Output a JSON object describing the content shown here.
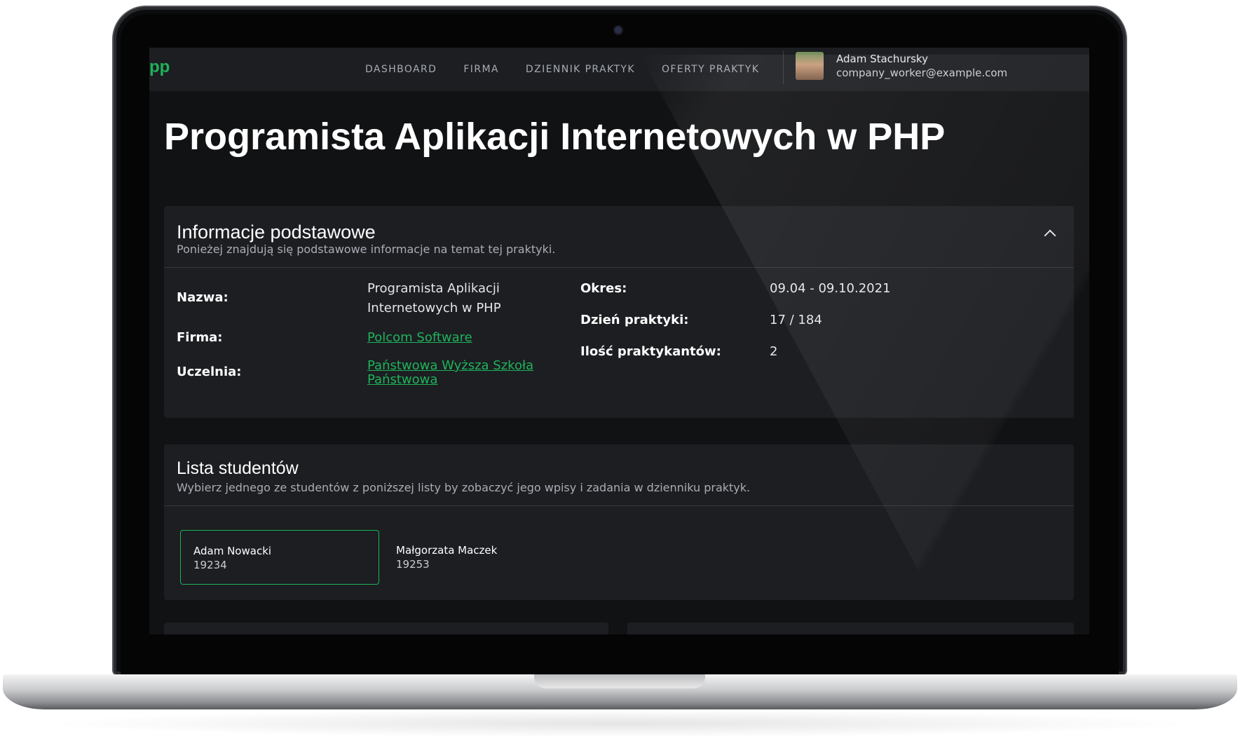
{
  "app": {
    "logo": "pp",
    "nav": [
      "DASHBOARD",
      "FIRMA",
      "DZIENNIK PRAKTYK",
      "OFERTY PRAKTYK"
    ],
    "user": {
      "name": "Adam Stachursky",
      "email": "company_worker@example.com"
    },
    "accent_color": "#1fb35a"
  },
  "page": {
    "title": "Programista Aplikacji Internetowych w PHP"
  },
  "basic_info": {
    "title": "Informacje podstawowe",
    "subtitle": "Ponieżej znajdują się podstawowe informacje na temat tej praktyki.",
    "labels": {
      "name": "Nazwa:",
      "company": "Firma:",
      "university": "Uczelnia:",
      "period": "Okres:",
      "day": "Dzień praktyki:",
      "count": "Ilość praktykantów:"
    },
    "values": {
      "name": "Programista Aplikacji Internetowych w PHP",
      "company": "Polcom Software",
      "university": "Państwowa Wyższa Szkoła Państwowa",
      "period": "09.04 - 09.10.2021",
      "day": "17 / 184",
      "count": "2"
    }
  },
  "students": {
    "title": "Lista studentów",
    "subtitle": "Wybierz jednego ze studentów z poniższej listy by zobaczyć jego wpisy i zadania w dzienniku praktyk.",
    "items": [
      {
        "name": "Adam Nowacki",
        "id": "19234"
      },
      {
        "name": "Małgorzata Maczek",
        "id": "19253"
      }
    ]
  }
}
